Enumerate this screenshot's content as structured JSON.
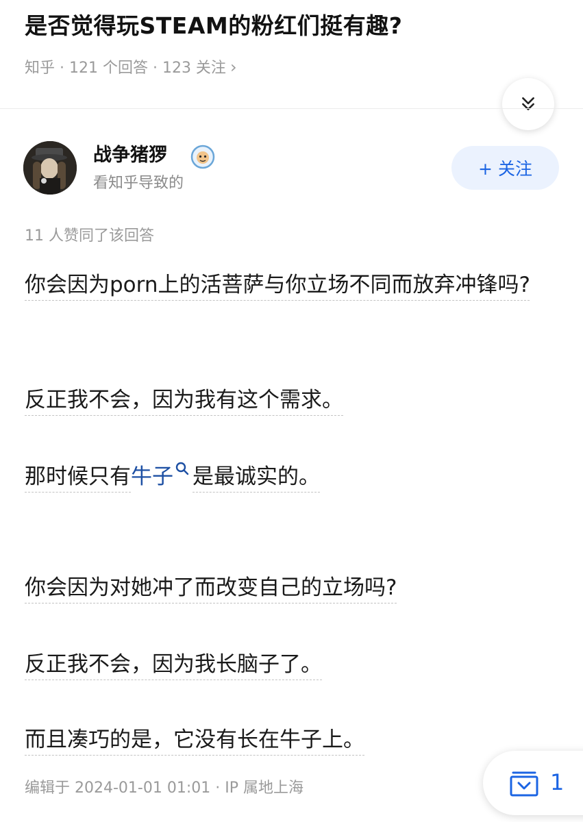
{
  "question": {
    "title": "是否觉得玩STEAM的粉红们挺有趣?",
    "meta": "知乎 · 121 个回答 · 123 关注",
    "meta_chevron": "›"
  },
  "author": {
    "name": "战争猪猡",
    "bio": "看知乎导致的",
    "follow_label": "+ 关注"
  },
  "answer": {
    "upvote_text": "11 人赞同了该回答",
    "paragraphs": [
      "你会因为porn上的活菩萨与你立场不同而放弃冲锋吗?",
      "反正我不会，因为我有这个需求。",
      "那时候只有牛子是最诚实的。",
      "你会因为对她冲了而改变自己的立场吗?",
      "反正我不会，因为我长脑子了。",
      "而且凑巧的是，它没有长在牛子上。"
    ],
    "p3_part1": "那时候只有",
    "p3_link": "牛子",
    "p3_part2": "是最诚实的。",
    "footer": "编辑于 2024-01-01 01:01 · IP 属地上海"
  },
  "collect": {
    "count": "1"
  },
  "colors": {
    "accent": "#1b64e3",
    "follow_bg": "#ebf2fe",
    "link": "#1c4fa3"
  },
  "icons": [
    "double-chevron-down-icon",
    "verified-badge-icon",
    "search-icon",
    "collection-icon"
  ]
}
